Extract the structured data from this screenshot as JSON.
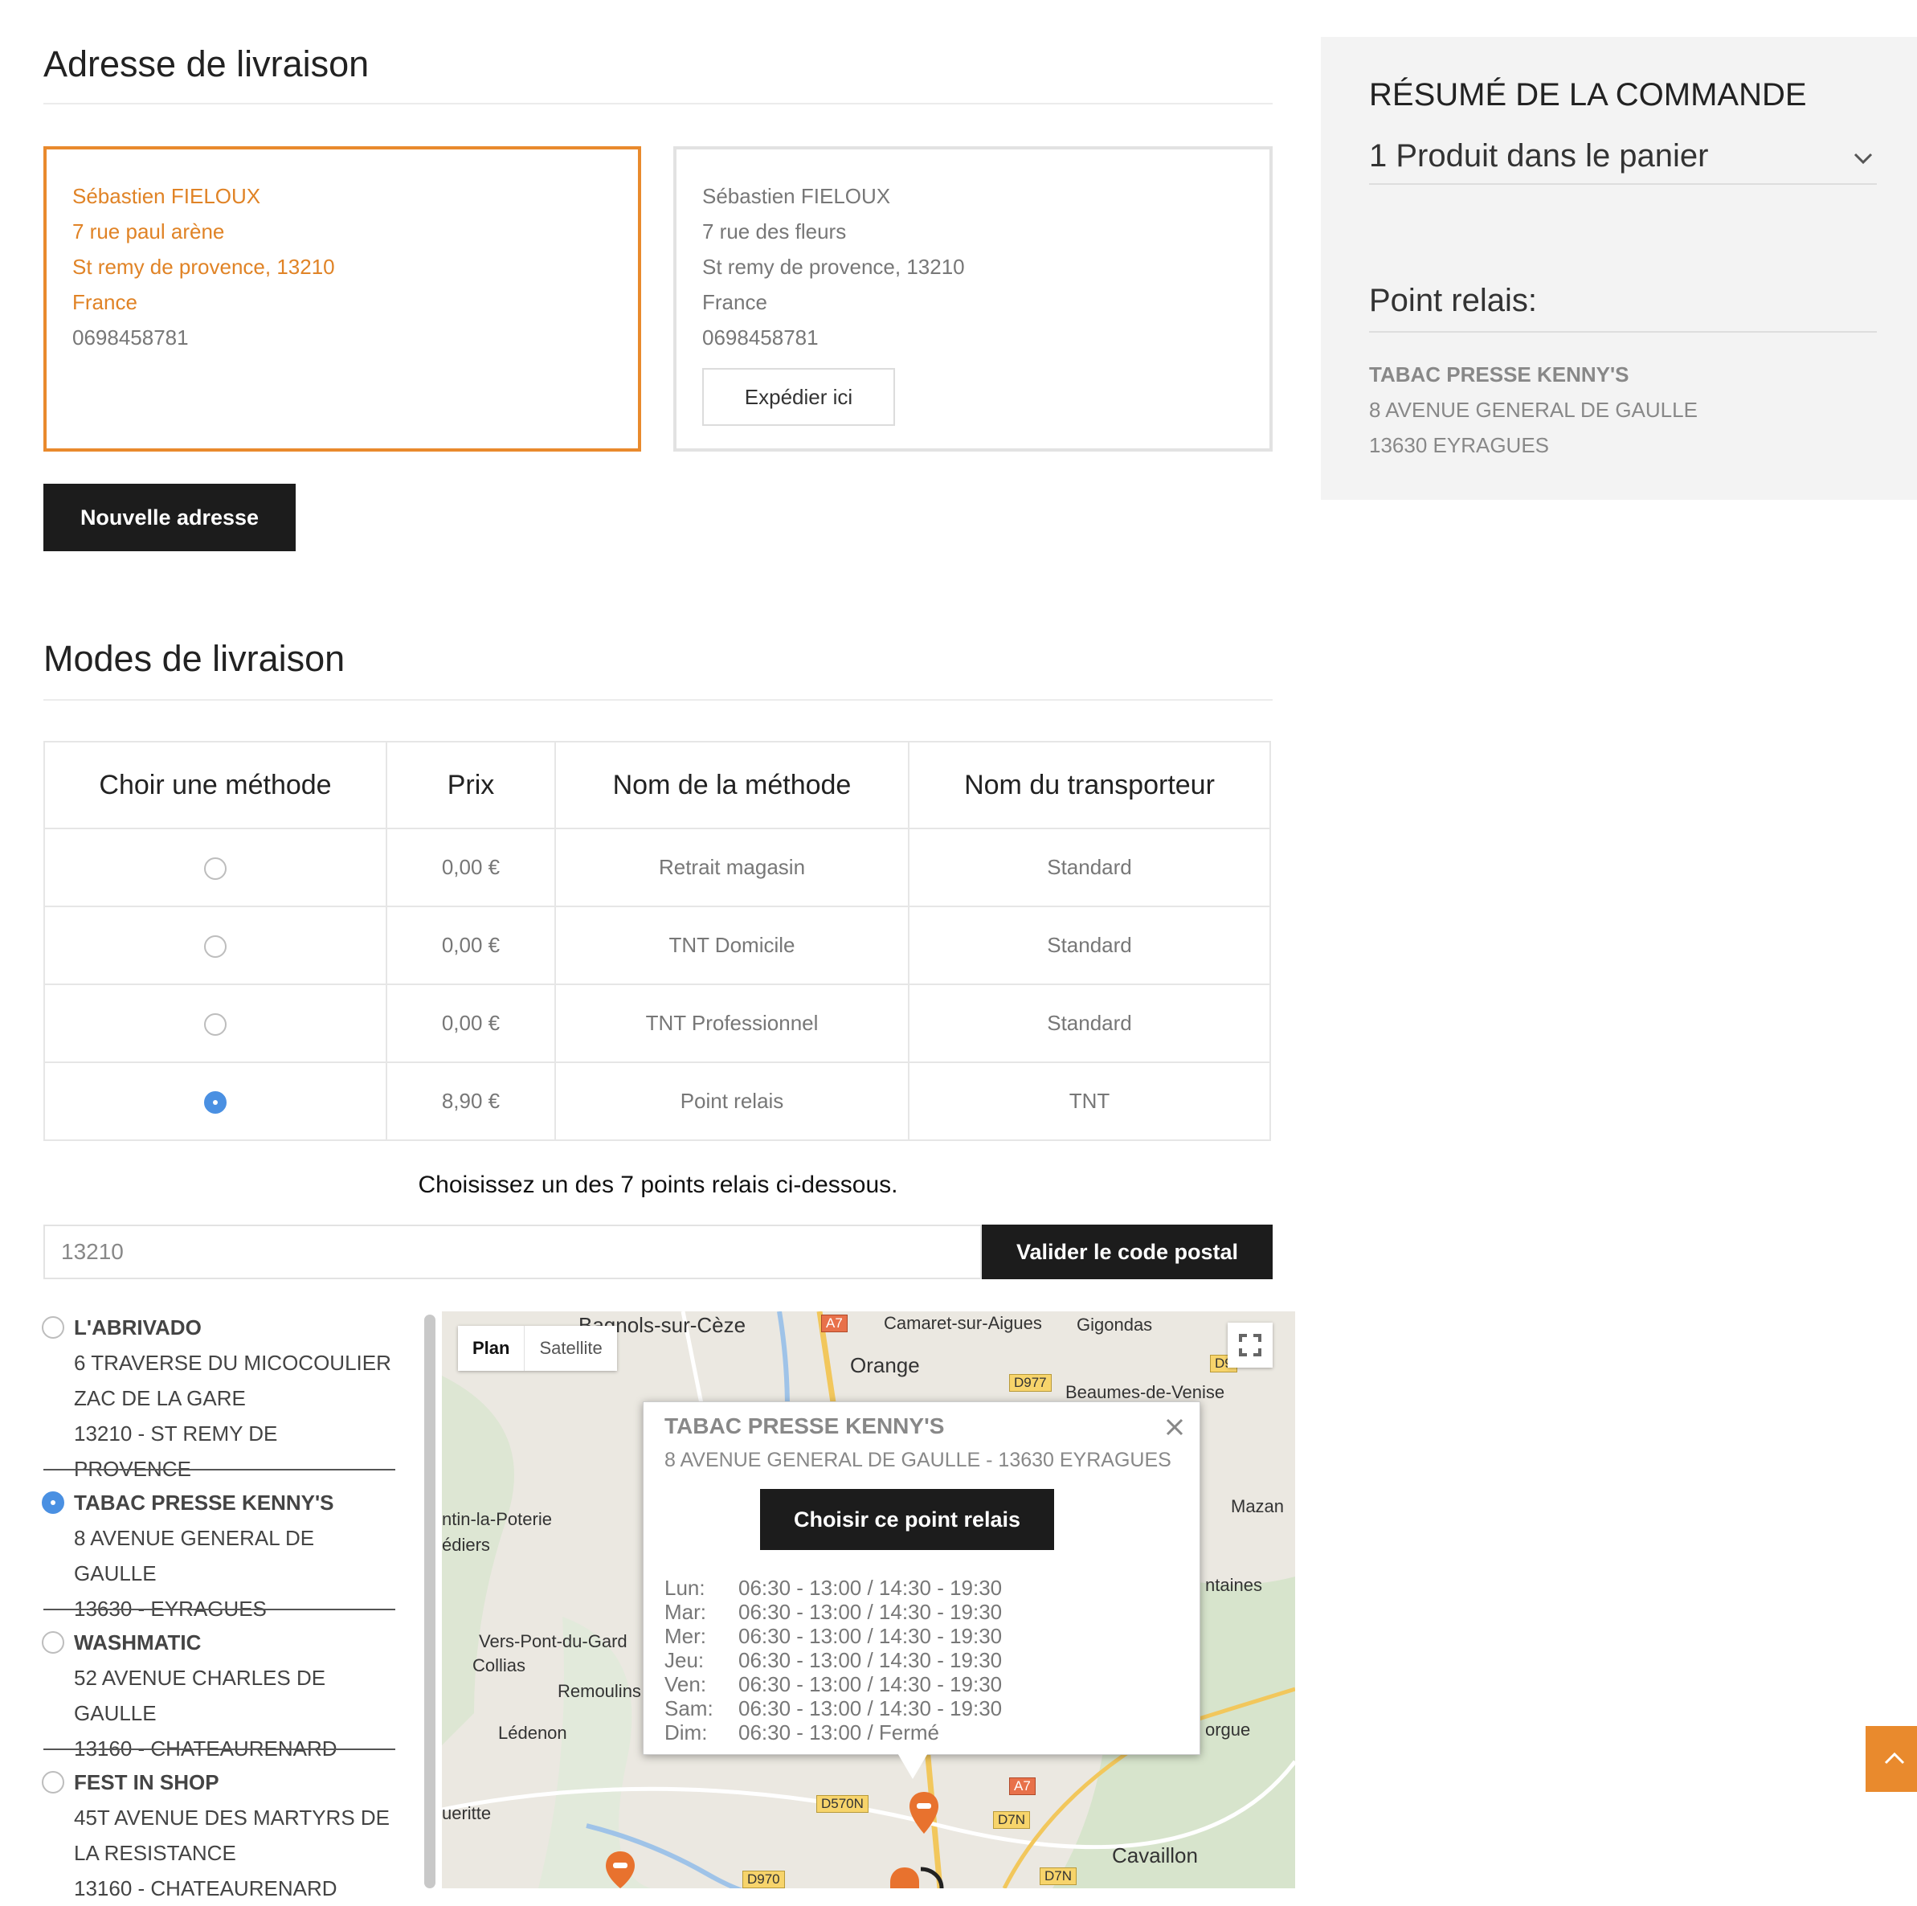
{
  "shipping": {
    "title": "Adresse de livraison",
    "selected_address": {
      "name": "Sébastien FIELOUX",
      "street": "7 rue paul arène",
      "city": "St remy de provence, 13210",
      "country": "France",
      "phone": "0698458781"
    },
    "other_address": {
      "name": "Sébastien FIELOUX",
      "street": "7 rue des fleurs",
      "city": "St remy de provence, 13210",
      "country": "France",
      "phone": "0698458781",
      "ship_here_label": "Expédier ici"
    },
    "new_address_label": "Nouvelle adresse"
  },
  "summary": {
    "title": "RÉSUMÉ DE LA COMMANDE",
    "cart_label": "1 Produit dans le panier",
    "relay_title": "Point relais:",
    "relay_name": "TABAC PRESSE KENNY'S",
    "relay_street": "8 AVENUE GENERAL DE GAULLE",
    "relay_city": "13630 EYRAGUES"
  },
  "methods": {
    "title": "Modes de livraison",
    "headers": [
      "Choir une méthode",
      "Prix",
      "Nom de la méthode",
      "Nom du transporteur"
    ],
    "rows": [
      {
        "price": "0,00 €",
        "method": "Retrait magasin",
        "carrier": "Standard",
        "checked": false
      },
      {
        "price": "0,00 €",
        "method": "TNT Domicile",
        "carrier": "Standard",
        "checked": false
      },
      {
        "price": "0,00 €",
        "method": "TNT Professionnel",
        "carrier": "Standard",
        "checked": false
      },
      {
        "price": "8,90 €",
        "method": "Point relais",
        "carrier": "TNT",
        "checked": true
      }
    ]
  },
  "relay": {
    "instruction": "Choisissez un des 7 points relais ci-dessous.",
    "postal_value": "13210",
    "validate_label": "Valider le code postal",
    "points": [
      {
        "name": "L'ABRIVADO",
        "lines": [
          "6 TRAVERSE DU MICOCOULIER",
          "ZAC DE LA GARE",
          "13210 - ST REMY DE PROVENCE"
        ],
        "checked": false
      },
      {
        "name": "TABAC PRESSE KENNY'S",
        "lines": [
          "8 AVENUE GENERAL DE GAULLE",
          "13630 - EYRAGUES"
        ],
        "checked": true
      },
      {
        "name": "WASHMATIC",
        "lines": [
          "52 AVENUE CHARLES DE GAULLE",
          "13160 - CHATEAURENARD"
        ],
        "checked": false
      },
      {
        "name": "FEST IN SHOP",
        "lines": [
          "45T AVENUE DES MARTYRS DE",
          "LA RESISTANCE",
          "13160 - CHATEAURENARD"
        ],
        "checked": false
      }
    ]
  },
  "map": {
    "tabs": [
      "Plan",
      "Satellite"
    ],
    "labels": [
      "Bagnols-sur-Cèze",
      "Camaret-sur-Aigues",
      "Gigondas",
      "Orange",
      "Beaumes-de-Venise",
      "ntin-la-Poterie",
      "édiers",
      "Vers-Pont-du-Gard",
      "Collias",
      "Remoulins",
      "Lédenon",
      "ueritte",
      "Mazan",
      "ntaines",
      "orgue",
      "Cavaillon"
    ],
    "roads": [
      "A7",
      "D977",
      "D9",
      "D570N",
      "A7",
      "D7N",
      "D970",
      "D7N"
    ],
    "popup": {
      "title": "TABAC PRESSE KENNY'S",
      "address": "8 AVENUE GENERAL DE GAULLE - 13630 EYRAGUES",
      "choose_label": "Choisir ce point relais",
      "hours": [
        {
          "day": "Lun:",
          "time": "06:30 - 13:00 / 14:30 - 19:30"
        },
        {
          "day": "Mar:",
          "time": "06:30 - 13:00 / 14:30 - 19:30"
        },
        {
          "day": "Mer:",
          "time": "06:30 - 13:00 / 14:30 - 19:30"
        },
        {
          "day": "Jeu:",
          "time": "06:30 - 13:00 / 14:30 - 19:30"
        },
        {
          "day": "Ven:",
          "time": "06:30 - 13:00 / 14:30 - 19:30"
        },
        {
          "day": "Sam:",
          "time": "06:30 - 13:00 / 14:30 - 19:30"
        },
        {
          "day": "Dim:",
          "time": "06:30 - 13:00 / Fermé"
        }
      ]
    }
  },
  "colors": {
    "accent": "#e98a2d",
    "selected_radio": "#4a90e2",
    "button_dark": "#1c1c1c"
  }
}
